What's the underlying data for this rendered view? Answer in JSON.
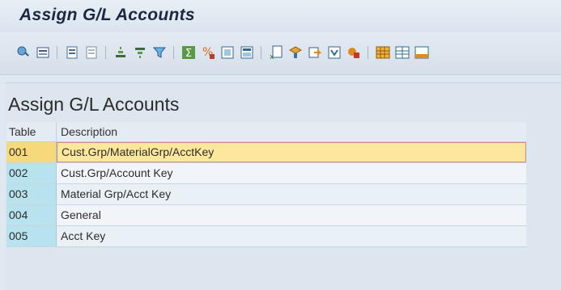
{
  "window": {
    "title": "Assign G/L Accounts"
  },
  "toolbar": {
    "icons": [
      "details-icon",
      "choose-layout-icon",
      "select-all-icon",
      "deselect-all-icon",
      "sort-ascending-icon",
      "sort-descending-icon",
      "filter-icon",
      "sum-icon",
      "subtotal-icon",
      "print-preview-icon",
      "layout-icon",
      "export-excel-icon",
      "find-icon",
      "find-next-icon",
      "word-processing-icon",
      "graphic-icon",
      "grid-icon",
      "insert-row-icon",
      "append-row-icon"
    ]
  },
  "table_title": "Assign G/L Accounts",
  "table": {
    "columns": [
      "Table",
      "Description"
    ],
    "rows": [
      {
        "table": "001",
        "description": "Cust.Grp/MaterialGrp/AcctKey",
        "selected": true
      },
      {
        "table": "002",
        "description": "Cust.Grp/Account Key"
      },
      {
        "table": "003",
        "description": "Material Grp/Acct Key"
      },
      {
        "table": "004",
        "description": "General"
      },
      {
        "table": "005",
        "description": "Acct Key"
      }
    ]
  },
  "colors": {
    "key_cell": "#b9e2ef",
    "selected_row": "#fde79c",
    "selected_border": "#d8888a"
  }
}
